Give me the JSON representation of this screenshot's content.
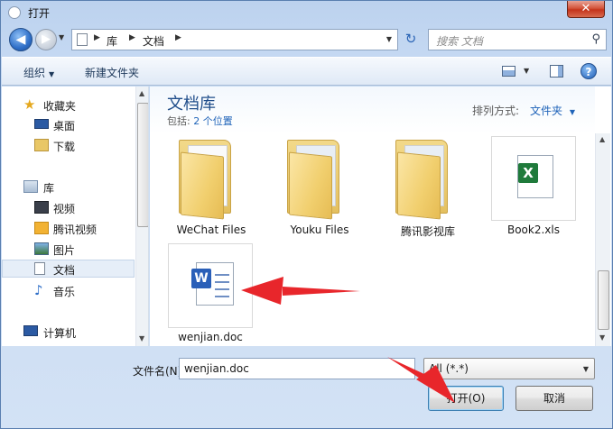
{
  "window": {
    "title": "打开",
    "close_label": "✕"
  },
  "nav": {
    "back_label": "◀",
    "forward_label": "▶",
    "recent_caret": "▼",
    "address_crumbs": [
      "库",
      "文档"
    ],
    "refresh_label": "↻",
    "search_placeholder": "搜索 文档"
  },
  "toolbar": {
    "organize_label": "组织",
    "new_folder_label": "新建文件夹"
  },
  "sidebar": {
    "items": [
      {
        "label": "收藏夹",
        "icon": "star-icon"
      },
      {
        "label": "桌面",
        "icon": "desktop-icon"
      },
      {
        "label": "下载",
        "icon": "downloads-icon"
      },
      {
        "label": "库",
        "icon": "libraries-icon"
      },
      {
        "label": "视频",
        "icon": "video-icon"
      },
      {
        "label": "腾讯视频",
        "icon": "tencent-video-icon"
      },
      {
        "label": "图片",
        "icon": "pictures-icon"
      },
      {
        "label": "文档",
        "icon": "documents-icon",
        "selected": true
      },
      {
        "label": "音乐",
        "icon": "music-icon"
      },
      {
        "label": "计算机",
        "icon": "computer-icon"
      }
    ]
  },
  "library": {
    "title": "文档库",
    "includes_prefix": "包括:",
    "includes_link": "2 个位置",
    "arrange_label": "排列方式:",
    "arrange_value": "文件夹"
  },
  "files": [
    {
      "name": "WeChat Files",
      "type": "folder"
    },
    {
      "name": "Youku Files",
      "type": "folder"
    },
    {
      "name": "腾讯影视库",
      "type": "folder"
    },
    {
      "name": "Book2.xls",
      "type": "excel"
    },
    {
      "name": "wenjian.doc",
      "type": "word"
    }
  ],
  "bottom": {
    "filename_label": "文件名(N):",
    "filename_value": "wenjian.doc",
    "filetype_value": "All (*.*)",
    "open_label": "打开(O)",
    "cancel_label": "取消"
  },
  "colors": {
    "annotation_arrow": "#e8262b",
    "library_title": "#1f4d8a",
    "link": "#2064b9"
  }
}
